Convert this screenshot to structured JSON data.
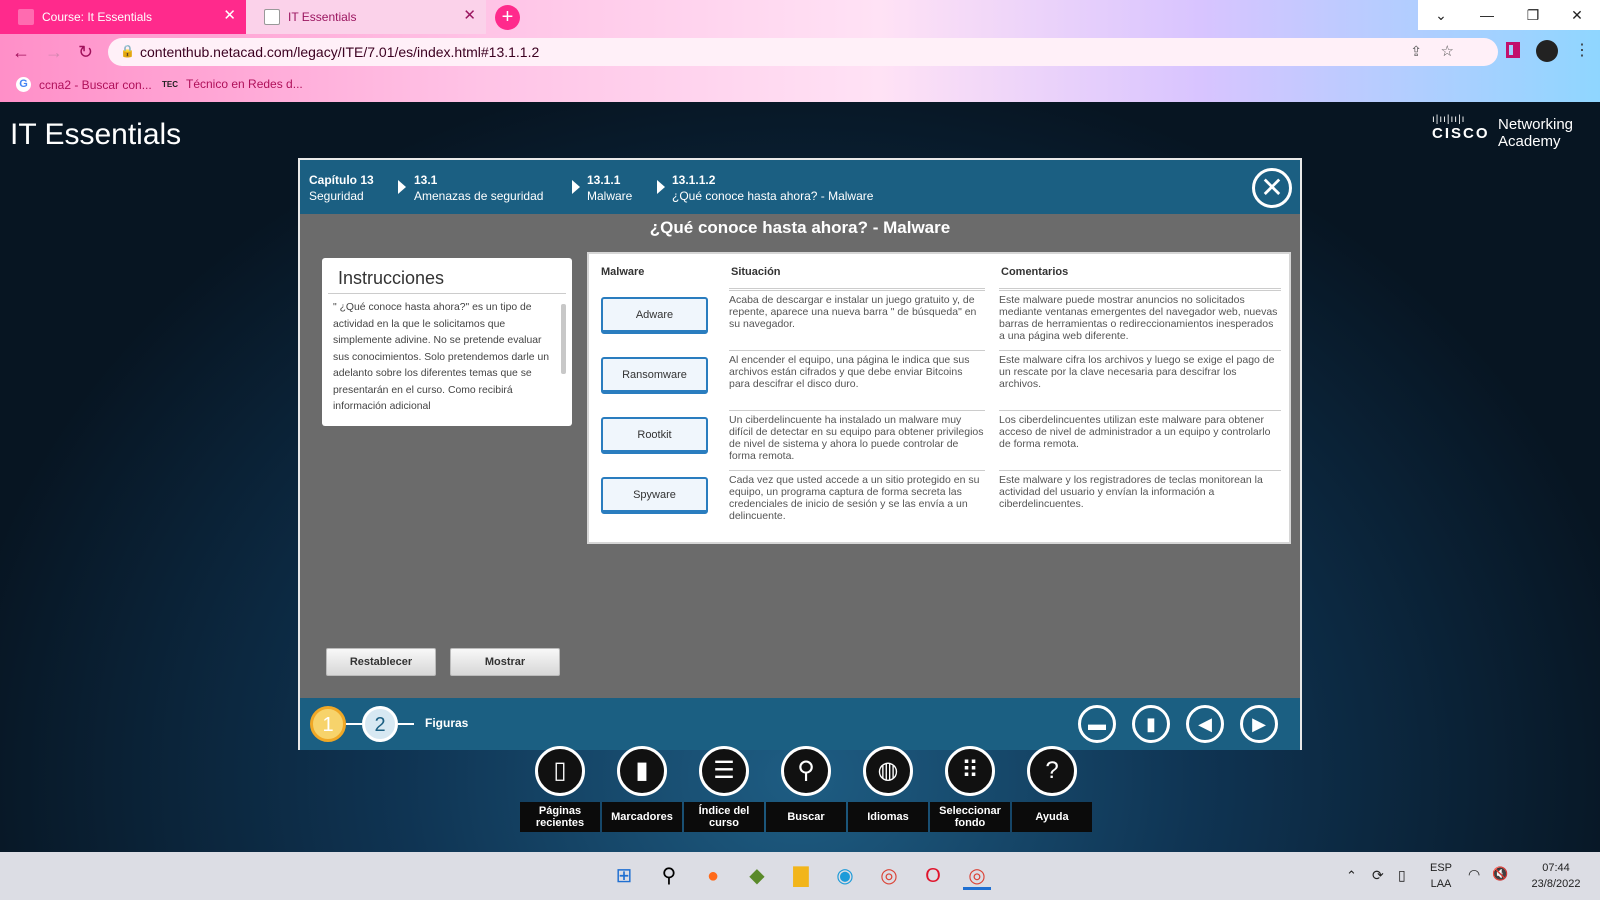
{
  "browser": {
    "tabs": [
      {
        "label": "Course: It Essentials",
        "active": true
      },
      {
        "label": "IT Essentials",
        "active": false
      }
    ],
    "new_tab": "+",
    "url": "contenthub.netacad.com/legacy/ITE/7.01/es/index.html#13.1.1.2",
    "bookmarks": [
      "ccna2 - Buscar con...",
      "Técnico en Redes d..."
    ],
    "bookmark_icon_text": "TEC"
  },
  "app": {
    "title": "IT Essentials",
    "logo": {
      "brand": "CISCO",
      "line1": "Networking",
      "line2": "Academy"
    }
  },
  "breadcrumb": [
    {
      "code": "Capítulo 13",
      "name": "Seguridad"
    },
    {
      "code": "13.1",
      "name": "Amenazas de seguridad"
    },
    {
      "code": "13.1.1",
      "name": "Malware"
    },
    {
      "code": "13.1.1.2",
      "name": "¿Qué conoce hasta ahora? - Malware"
    }
  ],
  "modal": {
    "title": "¿Qué conoce hasta ahora? - Malware",
    "instructions": {
      "heading": "Instrucciones",
      "text": "\" ¿Qué conoce hasta ahora?\" es un tipo de actividad en la que le solicitamos que simplemente adivine. No se pretende evaluar sus conocimientos. Solo pretendemos darle un adelanto sobre los diferentes temas que se presentarán en el curso. Como recibirá información adicional"
    },
    "table": {
      "headers": [
        "Malware",
        "Situación",
        "Comentarios"
      ],
      "rows": [
        {
          "malware": "Adware",
          "situacion": "Acaba de descargar e instalar un juego gratuito y, de repente, aparece una nueva barra \" de búsqueda\" en su navegador.",
          "comentario": "Este malware puede mostrar anuncios no solicitados mediante ventanas emergentes del navegador web, nuevas barras de herramientas o redireccionamientos inesperados a una página web diferente."
        },
        {
          "malware": "Ransomware",
          "situacion": "Al encender el equipo, una página le indica que sus archivos están cifrados y que debe enviar Bitcoins para descifrar el disco duro.",
          "comentario": "Este malware cifra los archivos y luego se exige el pago de un rescate por la clave necesaria para descifrar los archivos."
        },
        {
          "malware": "Rootkit",
          "situacion": "Un ciberdelincuente ha instalado un malware muy difícil de detectar en su equipo para obtener privilegios de nivel de sistema y ahora lo puede controlar de forma remota.",
          "comentario": "Los ciberdelincuentes utilizan este malware para obtener acceso de nivel de administrador a un equipo y controlarlo de forma remota."
        },
        {
          "malware": "Spyware",
          "situacion": "Cada vez que usted accede a un sitio protegido en su equipo, un programa captura de forma secreta las credenciales de inicio de sesión y se las envía a un delincuente.",
          "comentario": "Este malware y los registradores de teclas monitorean la actividad del usuario y envían la información a ciberdelincuentes."
        }
      ]
    },
    "buttons": {
      "reset": "Restablecer",
      "show": "Mostrar"
    },
    "footer": {
      "pages": [
        "1",
        "2"
      ],
      "figures": "Figuras",
      "current_page": 1
    }
  },
  "toolbar": [
    {
      "label": "Páginas recientes",
      "icon": "pages-icon"
    },
    {
      "label": "Marcadores",
      "icon": "bookmark-icon"
    },
    {
      "label": "Índice del curso",
      "icon": "list-icon"
    },
    {
      "label": "Buscar",
      "icon": "search-icon"
    },
    {
      "label": "Idiomas",
      "icon": "globe-icon"
    },
    {
      "label": "Seleccionar fondo",
      "icon": "grid-icon"
    },
    {
      "label": "Ayuda",
      "icon": "help-icon"
    }
  ],
  "taskbar": {
    "lang1": "ESP",
    "lang2": "LAA",
    "time": "07:44",
    "date": "23/8/2022"
  },
  "colors": {
    "header_blue": "#1b5f82",
    "tab_active": "#ff2a8c",
    "modal_bg": "#6b6b6b",
    "button_border": "#2a7dbf",
    "page_active": "#f0a826"
  }
}
